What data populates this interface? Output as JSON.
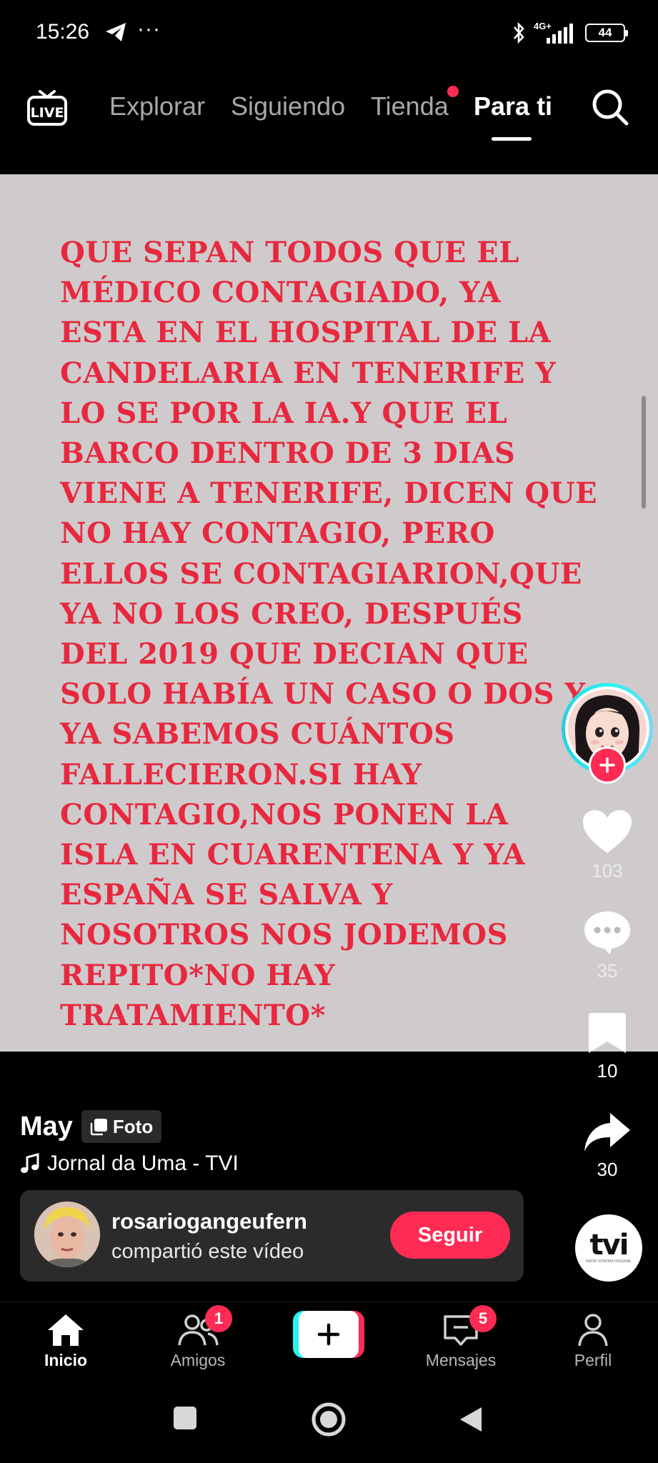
{
  "status_bar": {
    "time": "15:26",
    "dots": "···",
    "network": "4G+",
    "battery": "44"
  },
  "top_nav": {
    "live_label": "LIVE",
    "tabs": [
      {
        "label": "Explorar"
      },
      {
        "label": "Siguiendo"
      },
      {
        "label": "Tienda"
      },
      {
        "label": "Para ti"
      }
    ],
    "active_tab": "Para ti"
  },
  "post": {
    "text": "QUE SEPAN TODOS QUE EL\nMÉDICO CONTAGIADO, YA\nESTA EN EL HOSPITAL DE LA\nCANDELARIA EN TENERIFE Y\nLO SE POR LA IA.Y QUE EL\nBARCO DENTRO DE 3 DIAS\nVIENE A TENERIFE, DICEN QUE\nNO HAY CONTAGIO, PERO\nELLOS SE CONTAGIARION,QUE\nYA NO LOS CREO, DESPUÉS\nDEL 2019 QUE DECIAN QUE\nSOLO HABÍA UN CASO O DOS Y\nYA SABEMOS CUÁNTOS\nFALLECIERON.SI HAY\nCONTAGIO,NOS PONEN LA\nISLA EN CUARENTENA Y YA\nESPAÑA SE SALVA Y\nNOSOTROS NOS JODEMOS\nREPITO*NO HAY\nTRATAMIENTO*",
    "text_color": "#e8283e",
    "background": "#cfcbcc"
  },
  "actions": {
    "likes": "103",
    "comments": "35",
    "saves": "10",
    "shares": "30"
  },
  "music_disc": {
    "logo": "tvi",
    "sub": "RÁDIO SONORA ORIGINAL"
  },
  "info": {
    "author": "May",
    "type_badge": "Foto",
    "music": "Jornal da Uma - TVI"
  },
  "share_card": {
    "username": "rosariogangeufern",
    "action_text": "compartió este vídeo",
    "follow_label": "Seguir"
  },
  "tab_bar": {
    "inicio": "Inicio",
    "amigos": "Amigos",
    "amigos_badge": "1",
    "mensajes": "Mensajes",
    "mensajes_badge": "5",
    "perfil": "Perfil"
  },
  "colors": {
    "accent": "#fe2c55",
    "cyan": "#25f4ee"
  }
}
